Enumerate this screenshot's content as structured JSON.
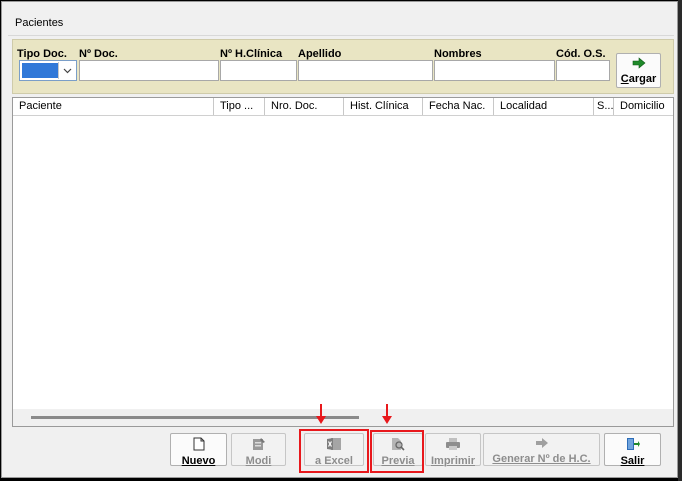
{
  "window": {
    "title": "Pacientes"
  },
  "filters": {
    "tipo_doc_label": "Tipo Doc.",
    "nro_doc_label": "Nº Doc.",
    "hclinica_label": "Nº  H.Clínica",
    "apellido_label": "Apellido",
    "nombres_label": "Nombres",
    "cod_os_label": "Cód. O.S.",
    "tipo_doc_value": "",
    "nro_doc_value": "",
    "hclinica_value": "",
    "apellido_value": "",
    "nombres_value": "",
    "cod_os_value": "",
    "cargar_label": "Cargar"
  },
  "grid": {
    "columns": [
      "Paciente",
      "Tipo ...",
      "Nro. Doc.",
      "Hist. Clínica",
      "Fecha Nac.",
      "Localidad",
      "S...",
      "Domicilio"
    ],
    "rows": []
  },
  "buttons": {
    "nuevo": "Nuevo",
    "modi": "Modi",
    "excel": "a Excel",
    "previa": "Previa",
    "imprimir": "Imprimir",
    "generar": "Generar Nº de H.C.",
    "salir": "Salir"
  },
  "colors": {
    "filter_bg": "#e9e5c3",
    "highlight": "#e8181c",
    "selection": "#3078d8"
  }
}
